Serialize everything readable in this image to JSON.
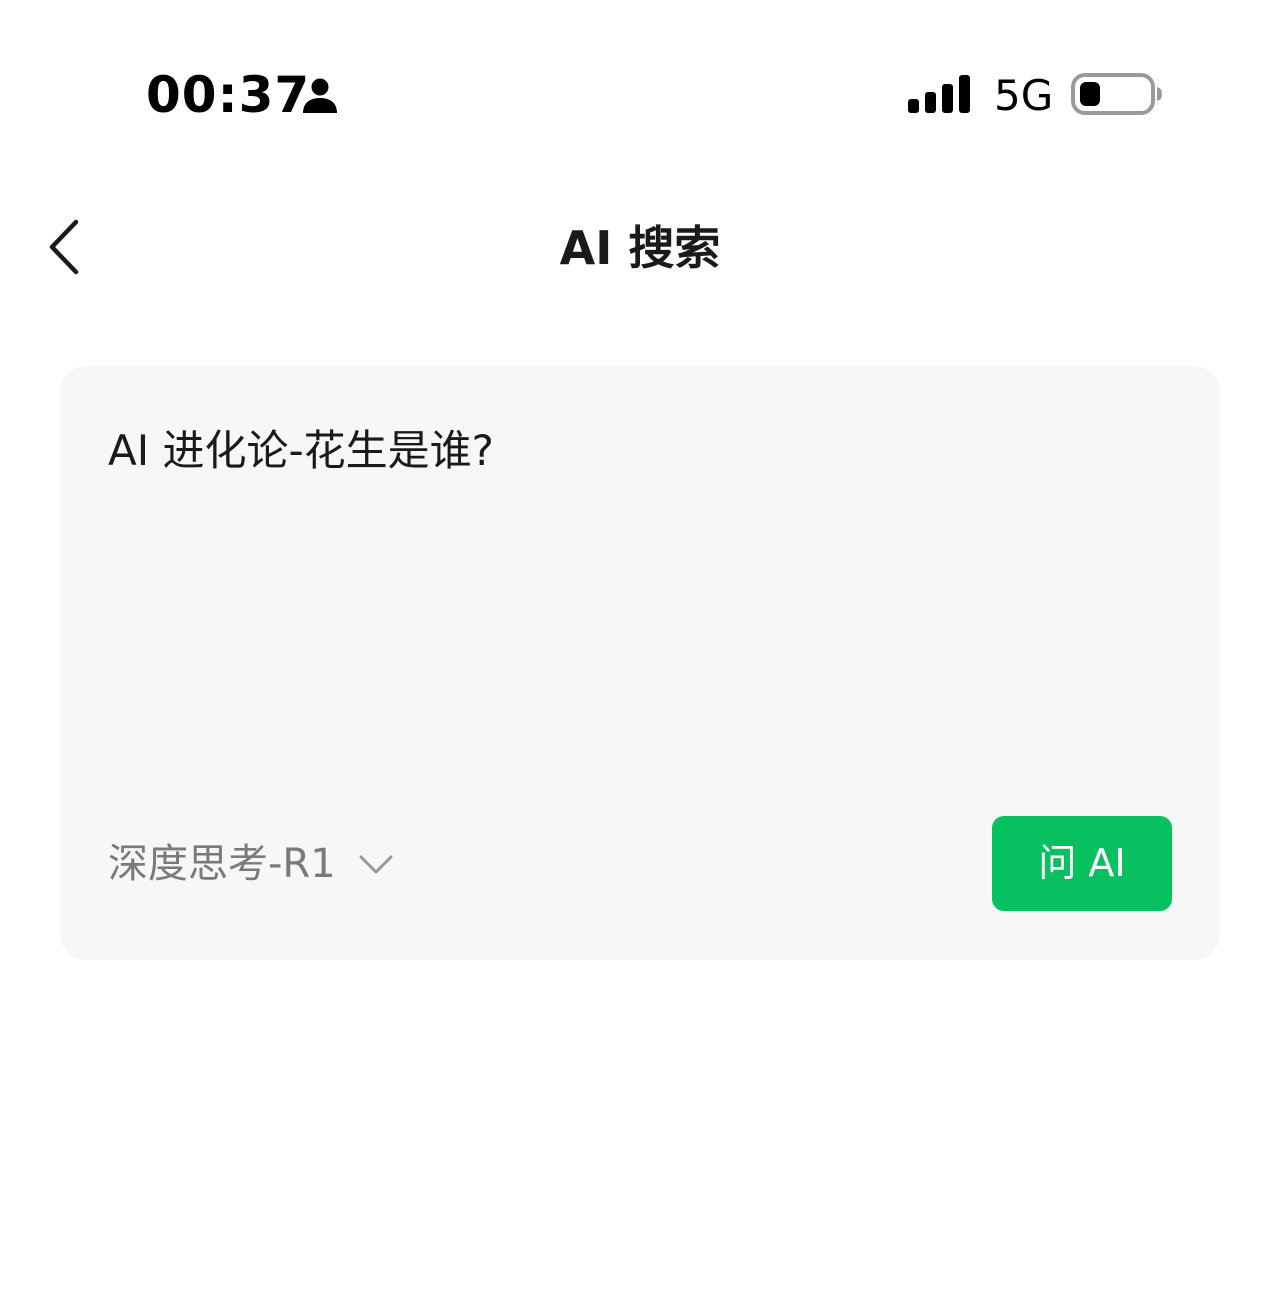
{
  "status_bar": {
    "time": "00:37",
    "network": "5G",
    "person_icon": "person-icon",
    "signal_icon": "signal-icon",
    "battery_icon": "battery-icon"
  },
  "nav": {
    "title": "AI 搜索",
    "back_icon": "chevron-left-icon"
  },
  "search": {
    "query": "AI 进化论-花生是谁?",
    "model_label": "深度思考-R1",
    "model_dropdown_icon": "chevron-down-icon",
    "ask_button_label": "问 AI"
  },
  "colors": {
    "accent": "#07c160",
    "card_background": "#f7f7f7",
    "secondary_text": "#7a7a7a"
  }
}
